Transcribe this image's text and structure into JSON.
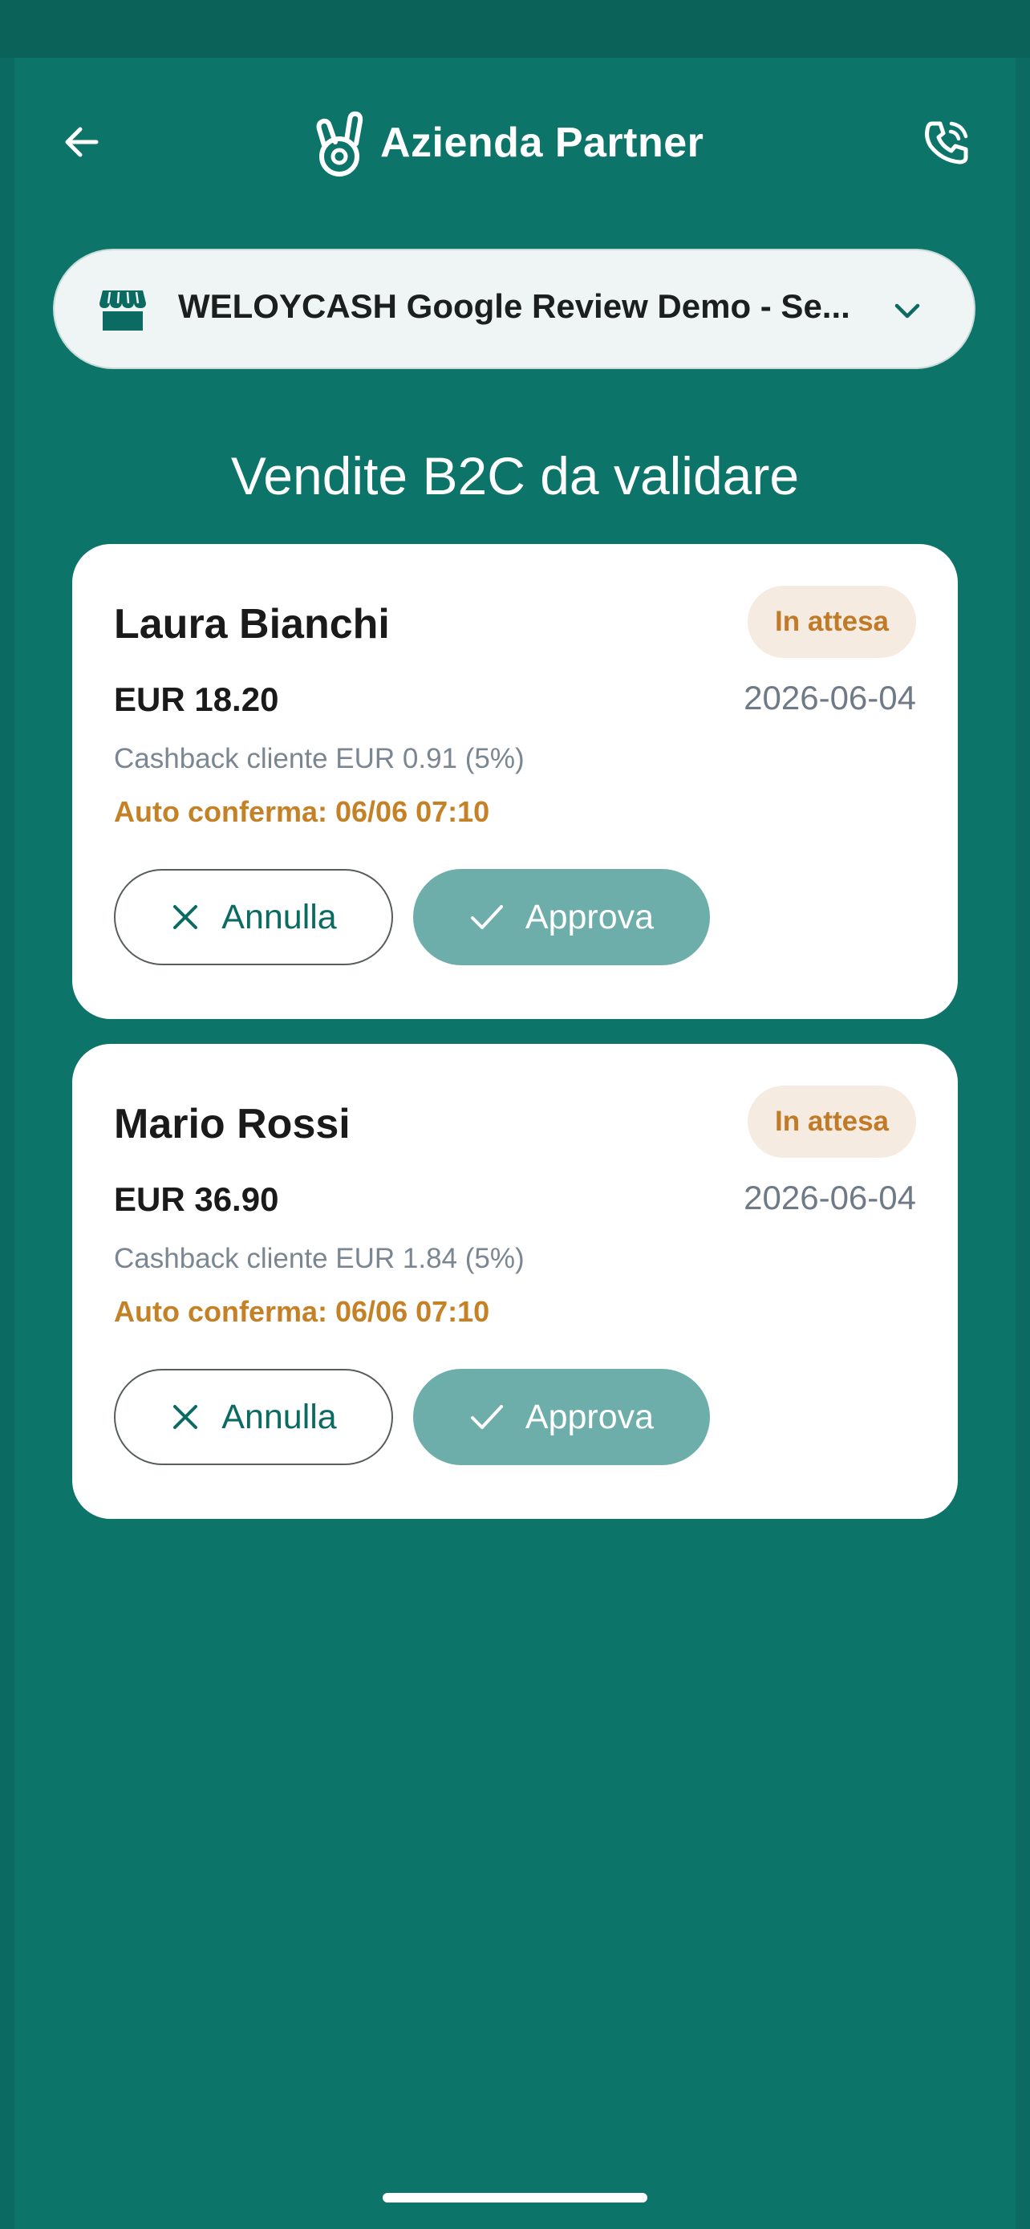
{
  "header": {
    "title": "Azienda Partner",
    "back_icon": "arrow-left-icon",
    "brand_icon": "brand-logo-icon",
    "call_icon": "phone-call-icon"
  },
  "store_selector": {
    "value": "WELOYCASH Google Review Demo - Se...",
    "store_icon": "store-icon",
    "chevron_icon": "chevron-down-icon"
  },
  "section_title": "Vendite B2C da validare",
  "sales": [
    {
      "customer": "Laura Bianchi",
      "status": "In attesa",
      "amount": "EUR 18.20",
      "date": "2026-06-04",
      "cashback": "Cashback cliente EUR 0.91 (5%)",
      "auto_confirm": "Auto conferma: 06/06 07:10",
      "cancel_label": "Annulla",
      "approve_label": "Approva"
    },
    {
      "customer": "Mario Rossi",
      "status": "In attesa",
      "amount": "EUR 36.90",
      "date": "2026-06-04",
      "cashback": "Cashback cliente EUR 1.84 (5%)",
      "auto_confirm": "Auto conferma: 06/06 07:10",
      "cancel_label": "Annulla",
      "approve_label": "Approva"
    }
  ],
  "colors": {
    "background": "#0b6b62",
    "badge_text": "#c17a28",
    "approve_button": "#6eaeaa"
  }
}
